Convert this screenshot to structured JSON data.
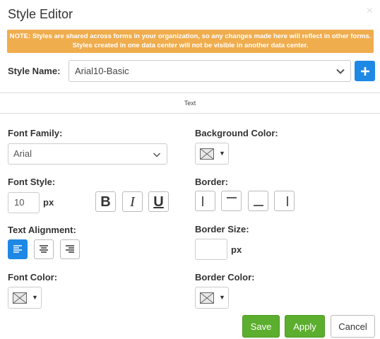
{
  "dialog": {
    "title": "Style Editor",
    "close_glyph": "×",
    "note": "NOTE: Styles are shared across forms in your organization, so any changes made here will reflect in other forms. Styles created in one data center will not be visible in another data center."
  },
  "style_name": {
    "label": "Style Name:",
    "value": "Arial10-Basic",
    "add_icon": "plus-icon"
  },
  "section": {
    "tab_label": "Text"
  },
  "font_family": {
    "label": "Font Family:",
    "value": "Arial"
  },
  "font_style": {
    "label": "Font Style:",
    "size": "10",
    "unit": "px",
    "bold_glyph": "B",
    "italic_glyph": "I",
    "underline_glyph": "U"
  },
  "text_alignment": {
    "label": "Text Alignment:",
    "selected": "left"
  },
  "font_color": {
    "label": "Font Color:",
    "caret": "▼"
  },
  "background_color": {
    "label": "Background Color:",
    "caret": "▼"
  },
  "border": {
    "label": "Border:"
  },
  "border_size": {
    "label": "Border Size:",
    "value": "",
    "unit": "px"
  },
  "border_color": {
    "label": "Border Color:",
    "caret": "▼"
  },
  "footer": {
    "save": "Save",
    "apply": "Apply",
    "cancel": "Cancel"
  },
  "colors": {
    "accent": "#1e88e5",
    "warning": "#f0ad4e",
    "success": "#5cae2e"
  }
}
